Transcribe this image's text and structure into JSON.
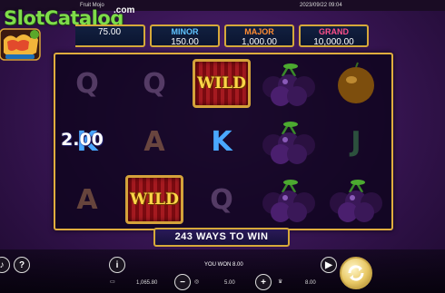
{
  "topbar": {
    "title": "Fruit Mojo",
    "datetime": "2023/09/22 09:04"
  },
  "watermark": {
    "text": "SlotCatalog",
    "suffix": ".com"
  },
  "jackpots": [
    {
      "name": "",
      "value": "75.00",
      "color": "#7ed321"
    },
    {
      "name": "MINOR",
      "value": "150.00",
      "color": "#5fc3ff"
    },
    {
      "name": "MAJOR",
      "value": "1,000.00",
      "color": "#ff8c33"
    },
    {
      "name": "GRAND",
      "value": "10,000.00",
      "color": "#ff4f8a"
    }
  ],
  "reels": [
    [
      "Q",
      "K",
      "A"
    ],
    [
      "Q",
      "A",
      "WILD"
    ],
    [
      "WILD",
      "K",
      "Q"
    ],
    [
      "plum",
      "plum",
      "plum"
    ],
    [
      "orange",
      "J",
      "plum"
    ]
  ],
  "reel_labels": {
    "wild": "WILD"
  },
  "multiplier": "2.00",
  "ways_banner": "243 WAYS TO WIN",
  "hud": {
    "info_icon": "i",
    "help_icon": "?",
    "won_label": "YOU WON 8.00",
    "balance": "1,065.80",
    "bet": "5.00",
    "win": "8.00"
  },
  "icons": [
    "speaker-icon",
    "help-icon",
    "info-icon",
    "wallet-icon",
    "minus-icon",
    "coins-icon",
    "plus-icon",
    "trophy-icon",
    "autoplay-icon",
    "spin-icon"
  ]
}
